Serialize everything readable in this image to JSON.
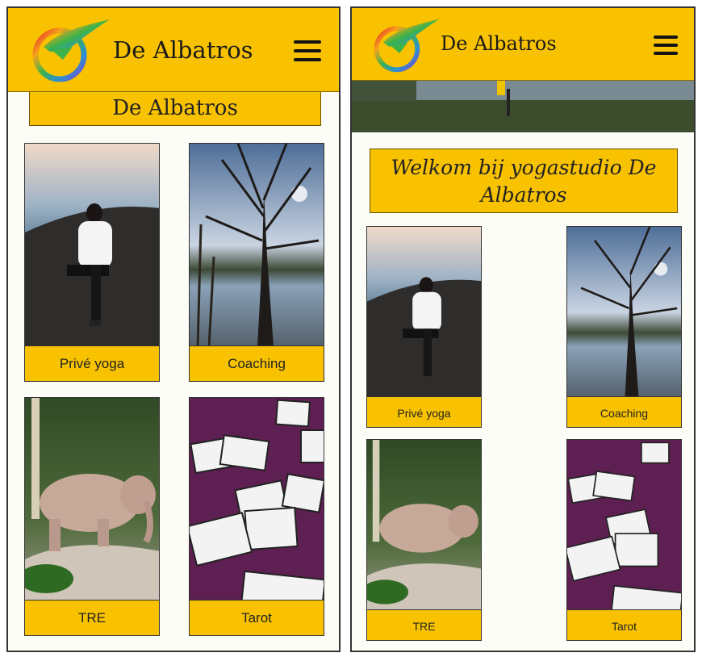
{
  "left_screen": {
    "header": {
      "brand": "De Albatros",
      "logo_icon": "albatros-logo-icon",
      "menu_icon": "hamburger-menu-icon"
    },
    "banner": "De Albatros",
    "cards": [
      {
        "label": "Privé yoga",
        "image": "yoga-beach-photo"
      },
      {
        "label": "Coaching",
        "image": "tree-lake-photo"
      },
      {
        "label": "TRE",
        "image": "elephant-photo"
      },
      {
        "label": "Tarot",
        "image": "tarot-cards-photo"
      }
    ]
  },
  "right_screen": {
    "header": {
      "brand": "De Albatros",
      "logo_icon": "albatros-logo-icon",
      "menu_icon": "hamburger-menu-icon"
    },
    "hero_image": "yoga-lake-photo",
    "welcome": "Welkom bij yogastudio De Albatros",
    "cards": [
      {
        "label": "Privé yoga",
        "image": "yoga-beach-photo"
      },
      {
        "label": "Coaching",
        "image": "tree-lake-photo"
      },
      {
        "label": "TRE",
        "image": "elephant-photo"
      },
      {
        "label": "Tarot",
        "image": "tarot-cards-photo"
      }
    ]
  },
  "colors": {
    "accent": "#f8c200",
    "background": "#fdfdf8",
    "tarot_purple": "#5e1f52"
  }
}
